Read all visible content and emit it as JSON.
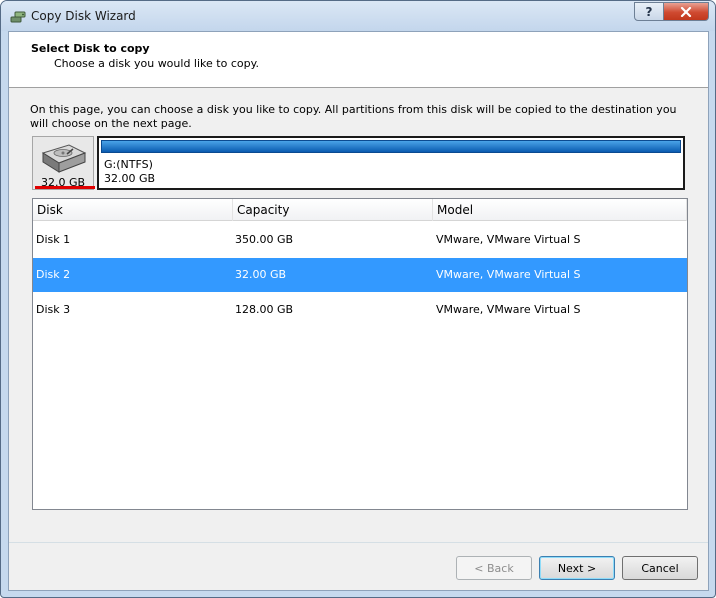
{
  "window": {
    "title": "Copy Disk Wizard",
    "help_label": "?"
  },
  "header": {
    "title": "Select Disk to copy",
    "subtitle": "Choose a disk you would like to copy."
  },
  "info": "On this page, you can choose a disk you like to copy. All partitions from this disk will be copied to the destination you will choose on the next page.",
  "disk_map": {
    "disk_size": "32.0 GB",
    "partition_name": "G:(NTFS)",
    "partition_size": "32.00 GB"
  },
  "table": {
    "columns": [
      "Disk",
      "Capacity",
      "Model"
    ],
    "rows": [
      {
        "disk": "Disk 1",
        "capacity": "350.00 GB",
        "model": "VMware, VMware Virtual S",
        "selected": false
      },
      {
        "disk": "Disk 2",
        "capacity": "32.00 GB",
        "model": "VMware, VMware Virtual S",
        "selected": true
      },
      {
        "disk": "Disk 3",
        "capacity": "128.00 GB",
        "model": "VMware, VMware Virtual S",
        "selected": false
      }
    ]
  },
  "buttons": {
    "back": "< Back",
    "next": "Next >",
    "cancel": "Cancel"
  },
  "icons": {
    "app": "disk-copy-icon",
    "close": "close-icon",
    "help": "help-icon",
    "disk": "hard-disk-icon"
  },
  "colors": {
    "selection": "#3399ff",
    "partition_bar": "#0a5bb0",
    "disk_marker": "#e00000"
  }
}
